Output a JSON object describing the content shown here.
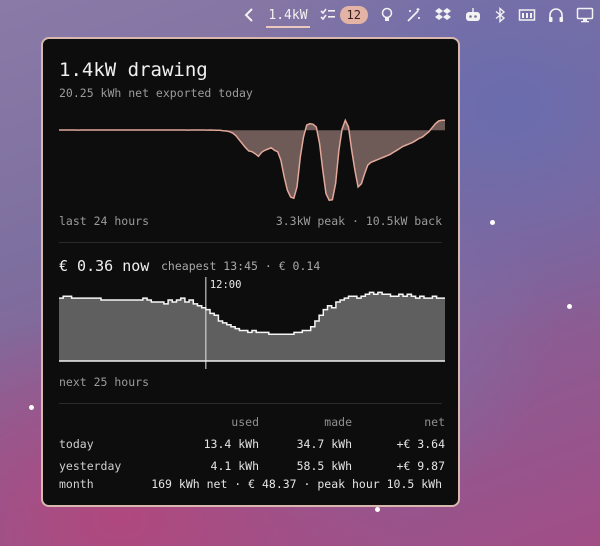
{
  "menubar": {
    "power_reading": "1.4kW",
    "tasks_count": "12",
    "icons": [
      "chevron-left-icon",
      "checklist-icon",
      "lightbulb-icon",
      "magic-wand-icon",
      "dropbox-icon",
      "robot-icon",
      "bluetooth-icon",
      "memory-icon",
      "headphones-icon",
      "display-icon"
    ]
  },
  "panel": {
    "title": "1.4kW drawing",
    "subtitle": "20.25 kWh net exported today",
    "power_chart": {
      "footer_left": "last 24 hours",
      "footer_right": "3.3kW peak · 10.5kW back",
      "values": [
        0.05,
        0.05,
        0.05,
        0.05,
        0.05,
        0.05,
        0.04,
        0.05,
        0.05,
        0.05,
        0.05,
        0.05,
        0.05,
        0.05,
        0.05,
        0.05,
        0.05,
        0.05,
        0.05,
        0.05,
        0.05,
        0.05,
        0.05,
        0.05,
        0.05,
        0.05,
        0.05,
        0.05,
        0.05,
        0.05,
        0.05,
        0.05,
        0.05,
        0.05,
        0.05,
        0.05,
        0.05,
        0.05,
        0.05,
        0.05,
        0.04,
        0.05,
        0.05,
        0.05,
        0.05,
        0.05,
        0.03,
        0.05,
        0.04,
        0.02,
        0.0,
        -0.05,
        -0.1,
        -0.2,
        -0.4,
        -0.8,
        -1.4,
        -2.0,
        -2.6,
        -3.1,
        -3.2,
        -3.5,
        -3.9,
        -3.3,
        -3.0,
        -2.8,
        -2.6,
        -3.0,
        -3.2,
        -4.5,
        -7.0,
        -9.0,
        -10.0,
        -10.2,
        -8.5,
        -4.0,
        -1.0,
        0.8,
        1.0,
        0.9,
        0.5,
        -2.0,
        -6.0,
        -9.5,
        -10.5,
        -10.4,
        -8.0,
        -3.0,
        0.2,
        1.5,
        0.5,
        -3.0,
        -6.0,
        -8.5,
        -8.0,
        -6.5,
        -5.2,
        -4.8,
        -4.6,
        -4.4,
        -4.2,
        -4.0,
        -3.8,
        -3.6,
        -3.3,
        -3.0,
        -2.7,
        -2.4,
        -2.2,
        -2.0,
        -1.8,
        -1.5,
        -1.2,
        -1.0,
        -0.6,
        -0.2,
        0.4,
        1.0,
        1.4,
        1.5,
        1.5
      ],
      "peak_kw": 3.3,
      "back_kw": 10.5
    },
    "price_now": "€ 0.36 now",
    "price_cheapest": "cheapest 13:45 · € 0.14",
    "price_chart": {
      "marker_label": "12:00",
      "footer": "next 25 hours",
      "values": [
        0.33,
        0.34,
        0.34,
        0.33,
        0.33,
        0.33,
        0.33,
        0.33,
        0.33,
        0.33,
        0.32,
        0.32,
        0.32,
        0.32,
        0.32,
        0.32,
        0.32,
        0.32,
        0.32,
        0.32,
        0.33,
        0.32,
        0.31,
        0.31,
        0.31,
        0.3,
        0.32,
        0.31,
        0.32,
        0.33,
        0.31,
        0.32,
        0.3,
        0.29,
        0.28,
        0.27,
        0.25,
        0.24,
        0.21,
        0.2,
        0.19,
        0.18,
        0.17,
        0.16,
        0.16,
        0.15,
        0.16,
        0.15,
        0.15,
        0.15,
        0.14,
        0.14,
        0.14,
        0.14,
        0.14,
        0.14,
        0.15,
        0.15,
        0.16,
        0.16,
        0.18,
        0.21,
        0.24,
        0.27,
        0.29,
        0.28,
        0.31,
        0.32,
        0.33,
        0.34,
        0.34,
        0.33,
        0.34,
        0.35,
        0.36,
        0.35,
        0.36,
        0.35,
        0.35,
        0.34,
        0.34,
        0.35,
        0.34,
        0.35,
        0.34,
        0.33,
        0.34,
        0.33,
        0.33,
        0.34,
        0.33,
        0.33
      ],
      "ylim": [
        0,
        0.42
      ],
      "marker_index": 35
    },
    "stats": {
      "headers": [
        "",
        "used",
        "made",
        "net"
      ],
      "rows": [
        [
          "today",
          "13.4 kWh",
          "34.7 kWh",
          "+€ 3.64"
        ],
        [
          "yesterday",
          "4.1 kWh",
          "58.5 kWh",
          "+€ 9.87"
        ]
      ],
      "month_label": "month",
      "month_value": "169 kWh net · € 48.37 · peak hour 10.5 kWh"
    }
  },
  "colors": {
    "panel_border": "#d8b8ae",
    "power_line": "#e3a89a",
    "power_fill": "#6e5a57",
    "price_fill": "#5f5f5f",
    "price_line": "#f5f5f5",
    "badge": "#e3b3a5"
  }
}
